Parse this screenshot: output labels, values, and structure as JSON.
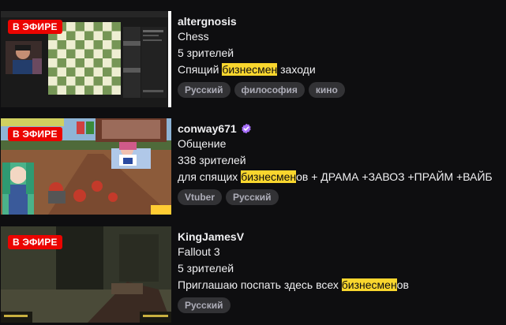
{
  "results": [
    {
      "live_label": "В ЭФИРЕ",
      "channel": "altergnosis",
      "verified": false,
      "category": "Chess",
      "viewers": "5 зрителей",
      "title_before": "Спящий ",
      "title_match": "бизнесмен",
      "title_after": " заходи",
      "tags": [
        "Русский",
        "философия",
        "кино"
      ]
    },
    {
      "live_label": "В ЭФИРЕ",
      "channel": "conway671",
      "verified": true,
      "category": "Общение",
      "viewers": "338 зрителей",
      "title_before": "для спящих ",
      "title_match": "бизнесмен",
      "title_after": "ов + ДРАМА +ЗАВОЗ +ПРАЙМ +ВАЙБ",
      "tags": [
        "Vtuber",
        "Русский"
      ]
    },
    {
      "live_label": "В ЭФИРЕ",
      "channel": "KingJamesV",
      "verified": false,
      "category": "Fallout 3",
      "viewers": "5 зрителей",
      "title_before": "Приглашаю поспать здесь всех ",
      "title_match": "бизнесмен",
      "title_after": "ов",
      "tags": [
        "Русский"
      ]
    }
  ],
  "colors": {
    "live_badge": "#eb0400",
    "highlight": "#f9d62e",
    "tag_bg": "#323235",
    "verified": "#a970ff"
  },
  "icons": {
    "verified": "verified-check-icon"
  }
}
